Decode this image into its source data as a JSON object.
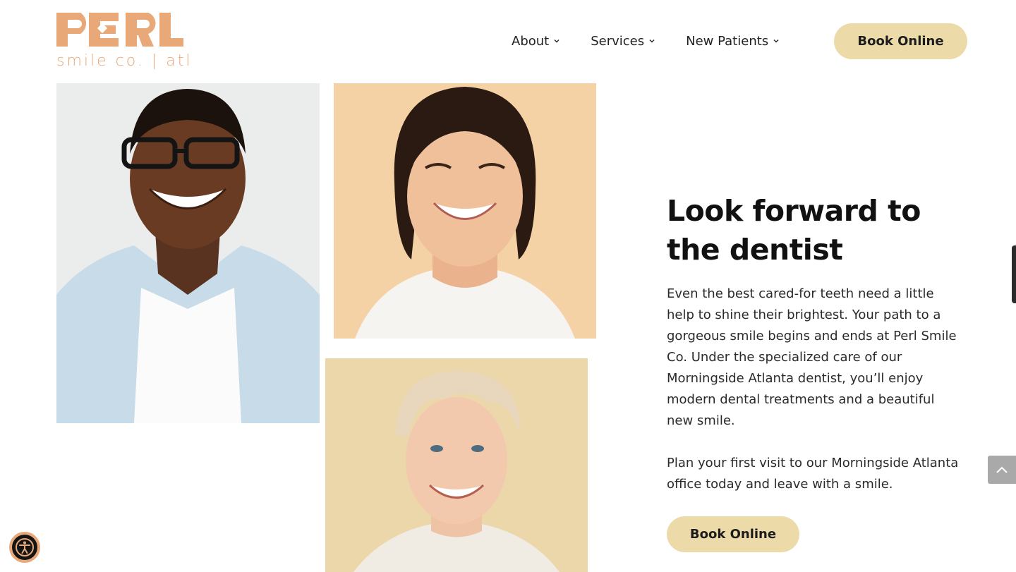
{
  "brand": {
    "logo_text": "PERL",
    "tagline": "smile co. | atl",
    "color": "#e8a877"
  },
  "nav": {
    "items": [
      {
        "label": "About"
      },
      {
        "label": "Services"
      },
      {
        "label": "New Patients"
      }
    ],
    "book_label": "Book Online"
  },
  "hero": {
    "headline": "Look forward to the dentist",
    "paragraph1": "Even the best cared-for teeth need a little help to shine their brightest. Your path to a gorgeous smile begins and ends at Perl Smile Co. Under the specialized care of our Morningside Atlanta dentist, you’ll enjoy modern dental treatments and a beautiful new smile.",
    "paragraph2": "Plan your first visit to our Morningside Atlanta office today and leave with a smile.",
    "book_label": "Book Online"
  },
  "colors": {
    "button_bg": "#ecdba9",
    "accent": "#e8a877"
  }
}
